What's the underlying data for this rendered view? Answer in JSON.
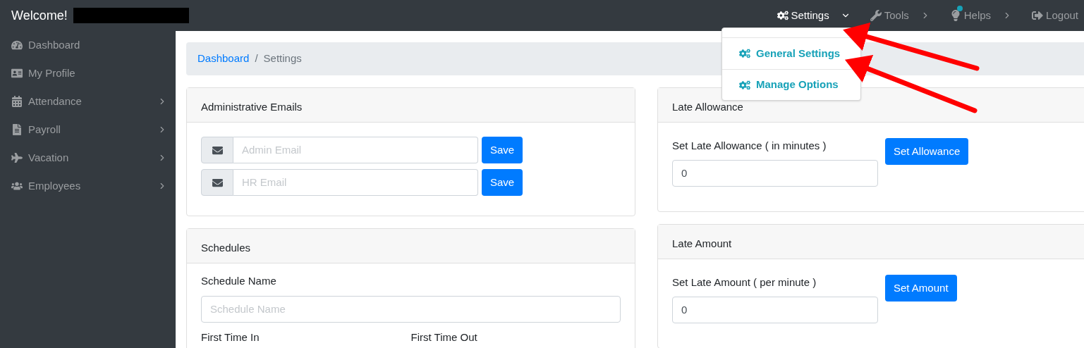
{
  "topbar": {
    "welcome": "Welcome!",
    "nav": [
      {
        "label": "Settings",
        "kind": "menu",
        "expanded": true,
        "notification": false
      },
      {
        "label": "Tools",
        "kind": "menu",
        "expanded": false,
        "notification": false
      },
      {
        "label": "Helps",
        "kind": "menu",
        "expanded": false,
        "notification": true
      },
      {
        "label": "Logout",
        "kind": "link",
        "expanded": false,
        "notification": false
      }
    ]
  },
  "dropdown": {
    "items": [
      {
        "label": "General Settings"
      },
      {
        "label": "Manage Options"
      }
    ]
  },
  "sidebar": {
    "items": [
      {
        "label": "Dashboard",
        "has_submenu": false
      },
      {
        "label": "My Profile",
        "has_submenu": false
      },
      {
        "label": "Attendance",
        "has_submenu": true
      },
      {
        "label": "Payroll",
        "has_submenu": true
      },
      {
        "label": "Vacation",
        "has_submenu": true
      },
      {
        "label": "Employees",
        "has_submenu": true
      }
    ]
  },
  "breadcrumb": {
    "separator": "/",
    "items": [
      {
        "label": "Dashboard",
        "kind": "link"
      },
      {
        "label": "Settings",
        "kind": "current"
      }
    ]
  },
  "admin_emails": {
    "title": "Administrative Emails",
    "rows": [
      {
        "placeholder": "Admin Email",
        "button": "Save"
      },
      {
        "placeholder": "HR Email",
        "button": "Save"
      }
    ]
  },
  "schedules": {
    "title": "Schedules",
    "name_label": "Schedule Name",
    "name_placeholder": "Schedule Name",
    "time_labels": [
      "First Time In",
      "First Time Out"
    ]
  },
  "right_cards": [
    {
      "title": "Late Allowance",
      "label": "Set Late Allowance ( in minutes )",
      "value": "0",
      "button": "Set Allowance"
    },
    {
      "title": "Late Amount",
      "label": "Set Late Amount ( per minute )",
      "value": "0",
      "button": "Set Amount"
    }
  ]
}
